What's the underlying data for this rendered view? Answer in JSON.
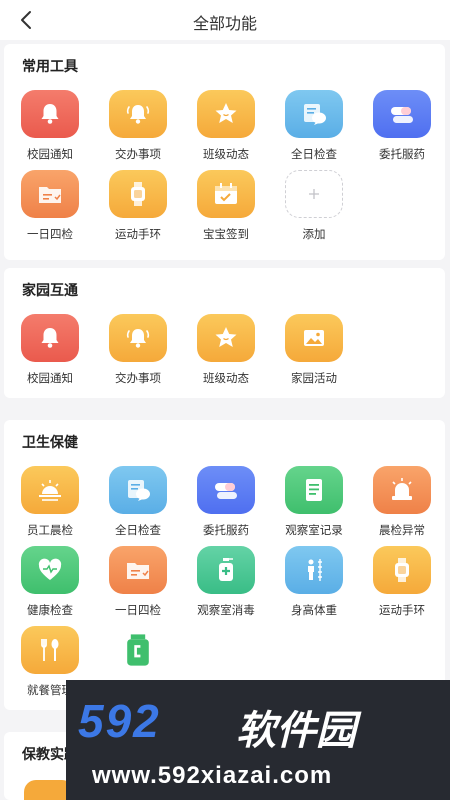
{
  "header": {
    "title": "全部功能",
    "back_icon": "chevron-left-icon"
  },
  "sections": [
    {
      "title": "常用工具",
      "items": [
        {
          "label": "校园通知",
          "icon": "bell-icon",
          "color": "#ea5a4d"
        },
        {
          "label": "交办事项",
          "icon": "ringing-bell-icon",
          "color": "#f5a93a"
        },
        {
          "label": "班级动态",
          "icon": "star-icon",
          "color": "#f5a93a"
        },
        {
          "label": "全日检查",
          "icon": "chat-doc-icon",
          "color": "#5aaee6"
        },
        {
          "label": "委托服药",
          "icon": "pill-icon",
          "color": "#4f6ff0"
        },
        {
          "label": "一日四检",
          "icon": "folder-icon",
          "color": "#ef8148"
        },
        {
          "label": "运动手环",
          "icon": "watch-icon",
          "color": "#f5a93a"
        },
        {
          "label": "宝宝签到",
          "icon": "calendar-check-icon",
          "color": "#f5a93a"
        },
        {
          "label": "添加",
          "icon": "plus-icon",
          "color": "#cfcfd4"
        }
      ]
    },
    {
      "title": "家园互通",
      "items": [
        {
          "label": "校园通知",
          "icon": "bell-icon",
          "color": "#ea5a4d"
        },
        {
          "label": "交办事项",
          "icon": "ringing-bell-icon",
          "color": "#f5a93a"
        },
        {
          "label": "班级动态",
          "icon": "star-icon",
          "color": "#f5a93a"
        },
        {
          "label": "家园活动",
          "icon": "picture-icon",
          "color": "#f5a93a"
        }
      ]
    },
    {
      "title": "卫生保健",
      "items": [
        {
          "label": "员工晨检",
          "icon": "sunrise-icon",
          "color": "#f5a93a"
        },
        {
          "label": "全日检查",
          "icon": "chat-doc-icon",
          "color": "#5aaee6"
        },
        {
          "label": "委托服药",
          "icon": "pill-icon",
          "color": "#4f6ff0"
        },
        {
          "label": "观察室记录",
          "icon": "document-icon",
          "color": "#3fbf6d"
        },
        {
          "label": "晨检异常",
          "icon": "alarm-light-icon",
          "color": "#ef8148"
        },
        {
          "label": "健康检查",
          "icon": "heart-icon",
          "color": "#3fbf6d"
        },
        {
          "label": "一日四检",
          "icon": "folder-icon",
          "color": "#ef8148"
        },
        {
          "label": "观察室消毒",
          "icon": "sanitizer-icon",
          "color": "#39bd86"
        },
        {
          "label": "身高体重",
          "icon": "height-icon",
          "color": "#5aaee6"
        },
        {
          "label": "运动手环",
          "icon": "watch-icon",
          "color": "#f5a93a"
        },
        {
          "label": "就餐管理",
          "icon": "utensils-icon",
          "color": "#f5a93a"
        },
        {
          "label": "",
          "icon": "jar-icon",
          "color": "#3fbf6d"
        }
      ]
    },
    {
      "title": "保教实践",
      "items": []
    }
  ],
  "watermark": {
    "brand": "592",
    "brand_cn": "软件园",
    "url": "www.592xiazai.com"
  }
}
